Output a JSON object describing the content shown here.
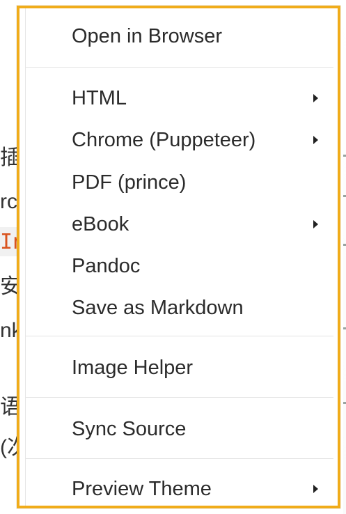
{
  "background": {
    "fragments": [
      "插",
      "rc",
      "In",
      "安",
      "nk",
      "语",
      "(次"
    ]
  },
  "menu": {
    "accent_color": "#f0ac1a",
    "items": [
      {
        "label": "Open in Browser",
        "has_submenu": false
      },
      {
        "label": "HTML",
        "has_submenu": true
      },
      {
        "label": "Chrome (Puppeteer)",
        "has_submenu": true
      },
      {
        "label": "PDF (prince)",
        "has_submenu": false
      },
      {
        "label": "eBook",
        "has_submenu": true
      },
      {
        "label": "Pandoc",
        "has_submenu": false
      },
      {
        "label": "Save as Markdown",
        "has_submenu": false
      },
      {
        "label": "Image Helper",
        "has_submenu": false
      },
      {
        "label": "Sync Source",
        "has_submenu": false
      },
      {
        "label": "Preview Theme",
        "has_submenu": true
      }
    ],
    "submenu_icon": "chevron-right-icon"
  }
}
